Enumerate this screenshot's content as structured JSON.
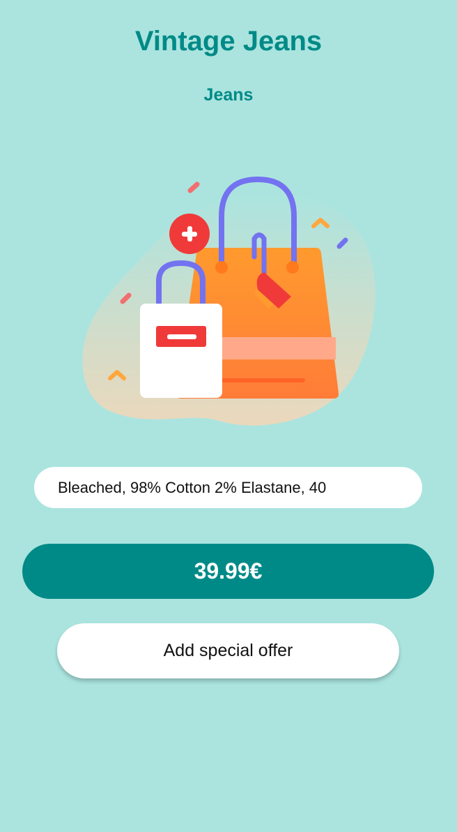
{
  "product": {
    "title": "Vintage Jeans",
    "category": "Jeans",
    "illustration_icon": "shopping-bags-illustration",
    "description": "Bleached, 98% Cotton 2% Elastane, 40",
    "price": "39.99€"
  },
  "actions": {
    "special_offer_label": "Add special offer"
  },
  "colors": {
    "background": "#ABE4DF",
    "accent": "#008A87",
    "bag_orange": "#FF8A30",
    "handle_purple": "#7372F0",
    "tag_red": "#F03A3A"
  }
}
